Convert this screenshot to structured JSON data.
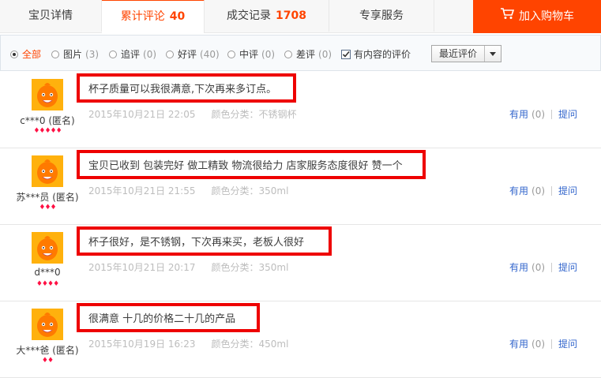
{
  "tabs": [
    {
      "label": "宝贝详情",
      "count": ""
    },
    {
      "label": "累计评论",
      "count": "40"
    },
    {
      "label": "成交记录",
      "count": "1708"
    },
    {
      "label": "专享服务",
      "count": ""
    }
  ],
  "cart": {
    "label": "加入购物车"
  },
  "filters": {
    "options": [
      {
        "label": "全部",
        "count": ""
      },
      {
        "label": "图片",
        "count": "(3)"
      },
      {
        "label": "追评",
        "count": "(0)"
      },
      {
        "label": "好评",
        "count": "(40)"
      },
      {
        "label": "中评",
        "count": "(0)"
      },
      {
        "label": "差评",
        "count": "(0)"
      }
    ],
    "content_only_label": "有内容的评价",
    "sort_label": "最近评价"
  },
  "actions": {
    "useful": "有用",
    "reply": "提问"
  },
  "reviews": [
    {
      "user": "c***0 (匿名)",
      "text": "杯子质量可以我很满意,下次再来多订点。",
      "date": "2015年10月21日 22:05",
      "sku": "颜色分类：不锈钢杯",
      "useful_count": "(0)",
      "badges": "♦♦♦♦♦"
    },
    {
      "user": "苏***员 (匿名)",
      "text": "宝贝已收到 包装完好 做工精致 物流很给力 店家服务态度很好 赞一个",
      "date": "2015年10月21日 21:55",
      "sku": "颜色分类：350ml",
      "useful_count": "(0)",
      "badges": "♦♦♦"
    },
    {
      "user": "d***0",
      "text": "杯子很好，是不锈钢，下次再来买，老板人很好",
      "date": "2015年10月21日 20:17",
      "sku": "颜色分类：350ml",
      "useful_count": "(0)",
      "badges": "♦♦♦♦"
    },
    {
      "user": "大***爸 (匿名)",
      "text": "很满意 十几的价格二十几的产品",
      "date": "2015年10月19日 16:23",
      "sku": "颜色分类：450ml",
      "useful_count": "(0)",
      "badges": "♦♦"
    }
  ],
  "colors": {
    "accent": "#ff4400",
    "highlight": "#ee0000",
    "link": "#3366cc"
  }
}
